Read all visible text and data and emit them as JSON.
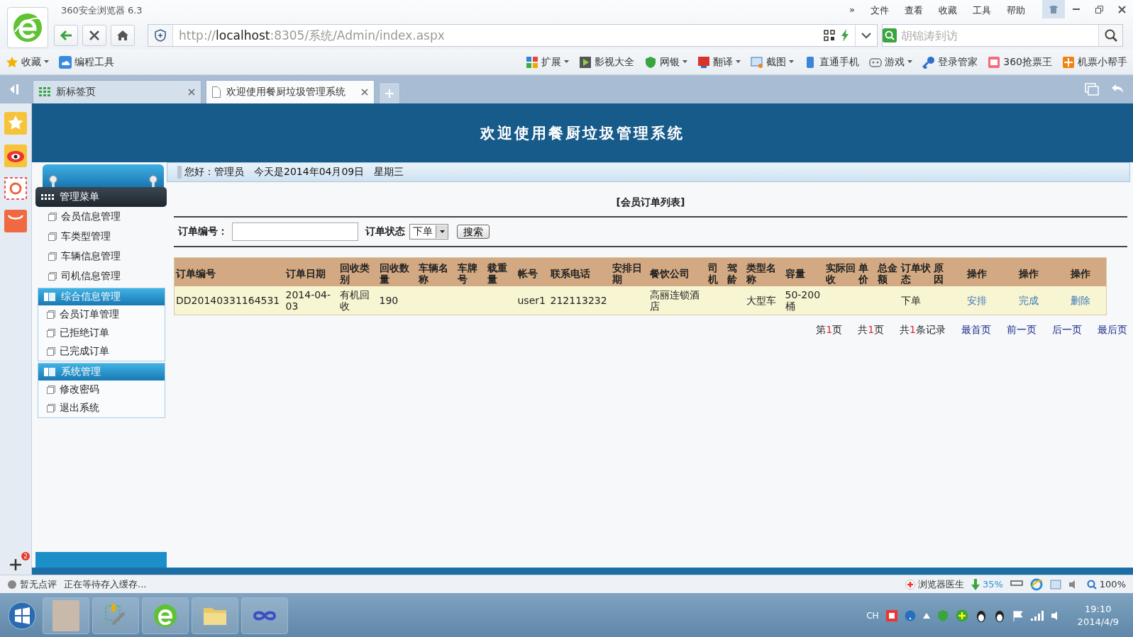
{
  "browser": {
    "title": "360安全浏览器 6.3",
    "menu": [
      "»",
      "文件",
      "查看",
      "收藏",
      "工具",
      "帮助"
    ],
    "url": {
      "scheme": "http://",
      "host": "localhost",
      "path": ":8305/系统/Admin/index.aspx"
    },
    "search": {
      "placeholder": "胡锦涛到访"
    },
    "bookmarks": [
      {
        "label": "收藏",
        "dropdown": true
      },
      {
        "label": "编程工具",
        "dropdown": false
      }
    ],
    "toolbar": [
      {
        "label": "扩展",
        "dropdown": true
      },
      {
        "label": "影视大全",
        "dropdown": false
      },
      {
        "label": "网银",
        "dropdown": true
      },
      {
        "label": "翻译",
        "dropdown": true
      },
      {
        "label": "截图",
        "dropdown": true
      },
      {
        "label": "直通手机",
        "dropdown": false
      },
      {
        "label": "游戏",
        "dropdown": true
      },
      {
        "label": "登录管家",
        "dropdown": false
      },
      {
        "label": "360抢票王",
        "dropdown": false
      },
      {
        "label": "机票小帮手",
        "dropdown": false
      }
    ],
    "tabs": [
      {
        "label": "新标签页",
        "selected": false
      },
      {
        "label": "欢迎使用餐厨垃圾管理系统",
        "selected": true
      }
    ],
    "sidebar_badge": "2"
  },
  "page": {
    "banner": "欢迎使用餐厨垃圾管理系统",
    "greeting": "您好：管理员",
    "date": "今天是2014年04月09日",
    "weekday": "星期三",
    "menu": {
      "title": "管理菜单",
      "items": [
        "会员信息管理",
        "车类型管理",
        "车辆信息管理",
        "司机信息管理"
      ],
      "sections": [
        {
          "title": "综合信息管理",
          "items": [
            "会员订单管理",
            "已拒绝订单",
            "已完成订单"
          ]
        },
        {
          "title": "系统管理",
          "items": [
            "修改密码",
            "退出系统"
          ]
        }
      ]
    },
    "list_title": "[会员订单列表]",
    "filter": {
      "order_no_label": "订单编号：",
      "status_label": "订单状态",
      "status_value": "下单",
      "search_button": "搜索"
    },
    "table": {
      "columns": [
        "订单编号",
        "订单日期",
        "回收类别",
        "回收数量",
        "车辆名称",
        "车牌号",
        "载重量",
        "帐号",
        "联系电话",
        "安排日期",
        "餐饮公司",
        "司机",
        "驾龄",
        "类型名称",
        "容量",
        "实际回收",
        "单价",
        "总金额",
        "订单状态",
        "原因",
        "操作",
        "操作",
        "操作"
      ],
      "rows": [
        {
          "cells": [
            "DD20140331164531",
            "2014-04-03",
            "有机回收",
            "190",
            null,
            null,
            null,
            "user1",
            "212113232",
            null,
            "高丽连锁酒店",
            null,
            null,
            "大型车",
            "50-200桶",
            null,
            null,
            null,
            "下单",
            null
          ],
          "actions": [
            "安排",
            "完成",
            "删除"
          ]
        }
      ]
    },
    "pagination": {
      "counts": [
        {
          "before": "第",
          "num": "1",
          "after": "页"
        },
        {
          "before": "共",
          "num": "1",
          "after": "页"
        },
        {
          "before": "共",
          "num": "1",
          "after": "条记录"
        }
      ],
      "links": [
        "最首页",
        "前一页",
        "后一页",
        "最后页"
      ]
    }
  },
  "status_bar": {
    "rating": "暂无点评",
    "message": "正在等待存入缓存...",
    "doctor": "浏览器医生",
    "download": "35%",
    "zoom": "100%"
  },
  "taskbar": {
    "language": "CH",
    "time": "19:10",
    "date": "2014/4/9"
  }
}
